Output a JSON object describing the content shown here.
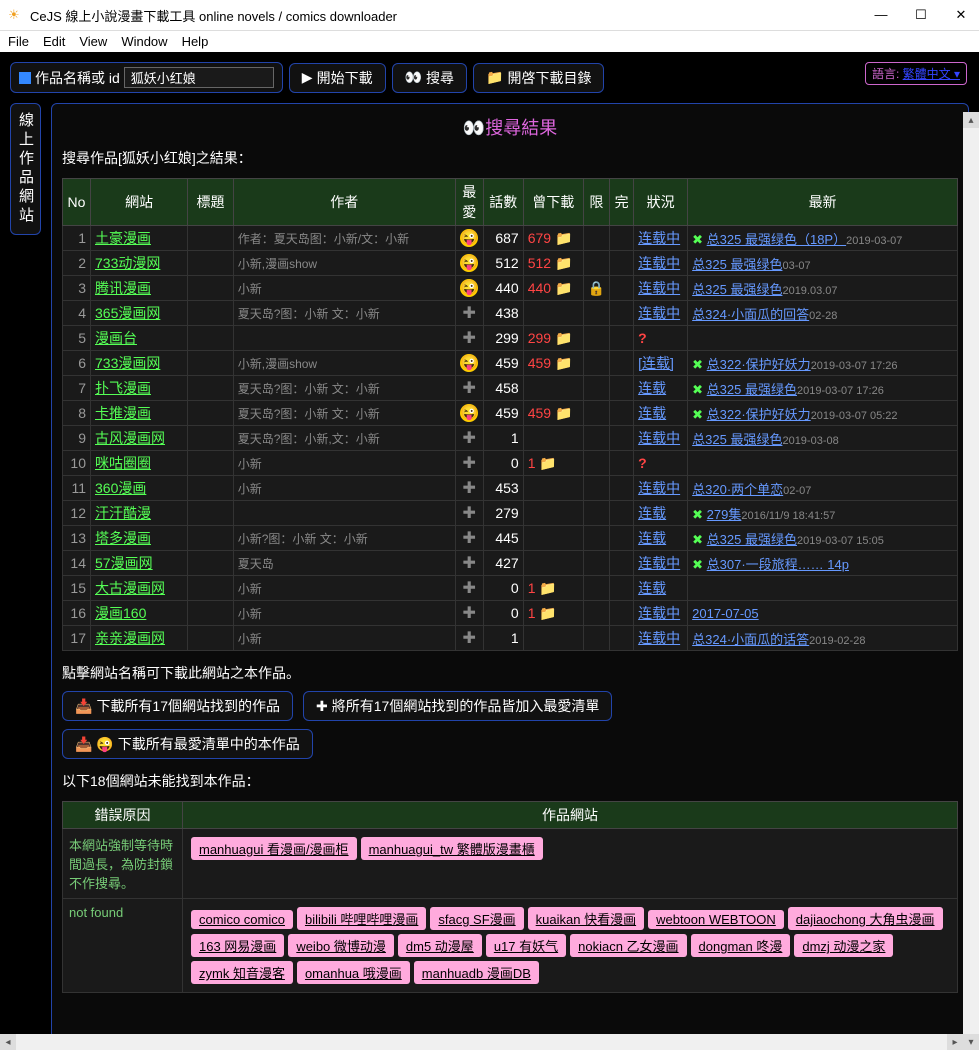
{
  "titlebar": "CeJS 線上小說漫畫下載工具 online novels / comics downloader",
  "menu": [
    "File",
    "Edit",
    "View",
    "Window",
    "Help"
  ],
  "input_label": "作品名稱或 id",
  "search_value": "狐妖小红娘",
  "btn_start": "開始下載",
  "btn_search": "搜尋",
  "btn_opendir": "開啓下載目錄",
  "lang_label": "語言:",
  "lang_value": "繁體中文 ▾",
  "sidebar": "線上作品網站",
  "results_title": "搜尋結果",
  "search_desc": "搜尋作品[狐妖小红娘]之結果：",
  "headers": [
    "No",
    "網站",
    "標題",
    "作者",
    "最愛",
    "話數",
    "曾下載",
    "限",
    "完",
    "狀況",
    "最新"
  ],
  "rows": [
    {
      "no": 1,
      "site": "土豪漫画",
      "author": "作者：夏天岛图：小新/文：小新",
      "fav": "face",
      "count": "687",
      "dl": "679",
      "folder": true,
      "limit": "",
      "status": "连载中",
      "cross": true,
      "latest": "总325 最强绿色（18P）",
      "date": "2019-03-07"
    },
    {
      "no": 2,
      "site": "733动漫网",
      "author": "小新,漫画show",
      "fav": "face",
      "count": "512",
      "dl": "512",
      "folder": true,
      "limit": "",
      "status": "连载中",
      "latest": "总325 最强绿色",
      "date": "03-07"
    },
    {
      "no": 3,
      "site": "腾讯漫画",
      "author": "小新",
      "fav": "face",
      "count": "440",
      "dl": "440",
      "folder": true,
      "limit": "🔒",
      "status": "连载中",
      "latest": "总325 最强绿色",
      "date": "2019.03.07"
    },
    {
      "no": 4,
      "site": "365漫画网",
      "author": "夏天岛?图：小新 文：小新",
      "fav": "plus",
      "count": "438",
      "dl": "",
      "status": "连载中",
      "latest": "总324·小面瓜的回答",
      "date": "02-28"
    },
    {
      "no": 5,
      "site": "漫画台",
      "author": "",
      "fav": "plus",
      "count": "299",
      "dl": "299",
      "folder": true,
      "status": "?",
      "q": true
    },
    {
      "no": 6,
      "site": "733漫画网",
      "author": "小新,漫画show",
      "fav": "face",
      "count": "459",
      "dl": "459",
      "folder": true,
      "status": "[连载]",
      "cross": true,
      "latest": "总322·保护好妖力",
      "date": "2019-03-07 17:26"
    },
    {
      "no": 7,
      "site": "扑飞漫画",
      "author": "夏天岛?图：小新 文：小新",
      "fav": "plus",
      "count": "458",
      "status": "连载",
      "cross": true,
      "latest": "总325 最强绿色",
      "date": "2019-03-07 17:26"
    },
    {
      "no": 8,
      "site": "卡推漫画",
      "author": "夏天岛?图：小新 文：小新",
      "fav": "face",
      "count": "459",
      "dl": "459",
      "folder": true,
      "status": "连载",
      "cross": true,
      "latest": "总322·保护好妖力",
      "date": "2019-03-07 05:22"
    },
    {
      "no": 9,
      "site": "古风漫画网",
      "author": "夏天岛?图：小新,文：小新",
      "fav": "plus",
      "count": "1",
      "status": "连载中",
      "latest": "总325 最强绿色",
      "date": "2019-03-08"
    },
    {
      "no": 10,
      "site": "咪咕圈圈",
      "author": "小新",
      "fav": "plus",
      "count": "0",
      "dl": "1",
      "folder": true,
      "status": "?",
      "q": true
    },
    {
      "no": 11,
      "site": "360漫画",
      "author": "小新",
      "fav": "plus",
      "count": "453",
      "status": "连载中",
      "latest": "总320·两个单恋",
      "date": "02-07"
    },
    {
      "no": 12,
      "site": "汗汗酷漫",
      "author": "",
      "fav": "plus",
      "count": "279",
      "status": "连载",
      "cross": true,
      "latest": "279集",
      "date": "2016/11/9 18:41:57"
    },
    {
      "no": 13,
      "site": "塔多漫画",
      "author": "小新?图：小新 文：小新",
      "fav": "plus",
      "count": "445",
      "status": "连载",
      "cross": true,
      "latest": "总325 最强绿色",
      "date": "2019-03-07 15:05"
    },
    {
      "no": 14,
      "site": "57漫画网",
      "author": "夏天岛",
      "fav": "plus",
      "count": "427",
      "status": "连载中",
      "cross": true,
      "latest": "总307·一段旅程…… 14p"
    },
    {
      "no": 15,
      "site": "大古漫画网",
      "author": "小新",
      "fav": "plus",
      "count": "0",
      "dl": "1",
      "folder": true,
      "status": "连载"
    },
    {
      "no": 16,
      "site": "漫画160",
      "author": "小新",
      "fav": "plus",
      "count": "0",
      "dl": "1",
      "folder": true,
      "status": "连载中",
      "latest": "2017-07-05"
    },
    {
      "no": 17,
      "site": "亲亲漫画网",
      "author": "小新",
      "fav": "plus",
      "count": "1",
      "status": "连载中",
      "latest": "总324·小面瓜的话答",
      "date": "2019-02-28"
    }
  ],
  "note1": "點擊網站名稱可下載此網站之本作品。",
  "btn_dl_all": "下載所有17個網站找到的作品",
  "btn_add_all": "將所有17個網站找到的作品皆加入最愛清單",
  "btn_dl_fav": "下載所有最愛清單中的本作品",
  "note2": "以下18個網站未能找到本作品：",
  "nf_headers": [
    "錯誤原因",
    "作品網站"
  ],
  "nf_rows": [
    {
      "reason": "本網站強制等待時間過長，為防封鎖不作搜尋。",
      "sites": [
        "manhuagui 看漫画/漫画柜",
        "manhuagui_tw 繁體版漫畫櫃"
      ]
    },
    {
      "reason": "not found",
      "sites": [
        "comico comico",
        "bilibili 哔哩哔哩漫画",
        "sfacg SF漫画",
        "kuaikan 快看漫画",
        "webtoon WEBTOON",
        "dajiaochong 大角虫漫画",
        "163 网易漫画",
        "weibo 微博动漫",
        "dm5 动漫屋",
        "u17 有妖气",
        "nokiacn 乙女漫画",
        "dongman 咚漫",
        "dmzj 动漫之家",
        "zymk 知音漫客",
        "omanhua 哦漫画",
        "manhuadb 漫画DB"
      ]
    }
  ]
}
